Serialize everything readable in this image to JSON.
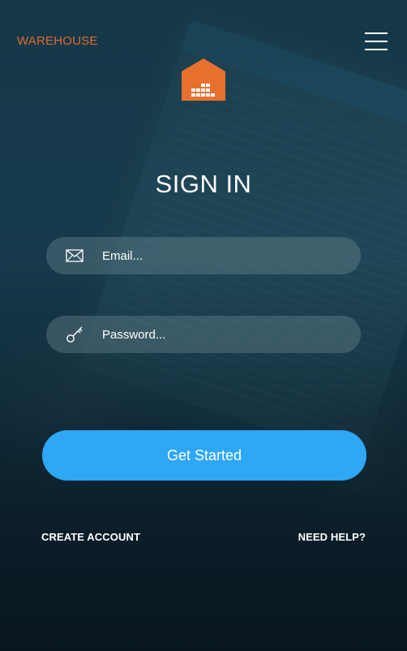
{
  "header": {
    "brand": "WAREHOUSE",
    "menu_icon": "hamburger-menu-icon",
    "logo_icon": "warehouse-logo-icon"
  },
  "signin": {
    "title": "SIGN IN",
    "email": {
      "icon": "envelope-icon",
      "placeholder": "Email...",
      "value": ""
    },
    "password": {
      "icon": "key-icon",
      "placeholder": "Password...",
      "value": ""
    },
    "submit_label": "Get Started"
  },
  "footer": {
    "create_account": "CREATE ACCOUNT",
    "need_help": "NEED HELP?"
  },
  "colors": {
    "brand": "#e06a2f",
    "button": "#2ea7f5",
    "text": "#ffffff"
  }
}
